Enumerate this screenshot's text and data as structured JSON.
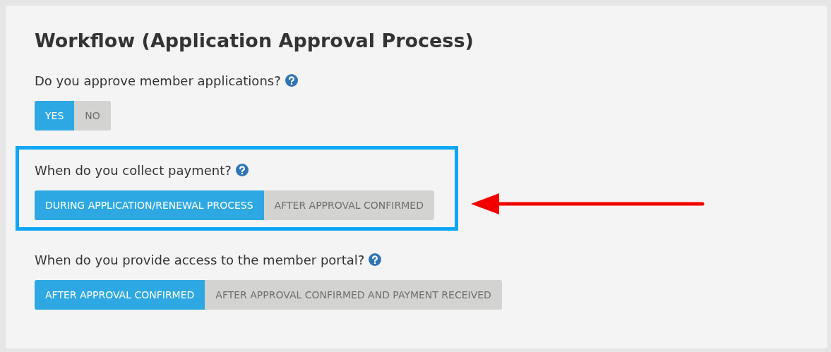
{
  "title": "Workflow (Application Approval Process)",
  "questions": [
    {
      "label": "Do you approve member applications?",
      "highlighted": false,
      "options": [
        {
          "label": "YES",
          "selected": true
        },
        {
          "label": "NO",
          "selected": false
        }
      ]
    },
    {
      "label": "When do you collect payment?",
      "highlighted": true,
      "options": [
        {
          "label": "DURING APPLICATION/RENEWAL PROCESS",
          "selected": true
        },
        {
          "label": "AFTER APPROVAL CONFIRMED",
          "selected": false
        }
      ]
    },
    {
      "label": "When do you provide access to the member portal?",
      "highlighted": false,
      "options": [
        {
          "label": "AFTER APPROVAL CONFIRMED",
          "selected": true
        },
        {
          "label": "AFTER APPROVAL CONFIRMED AND PAYMENT RECEIVED",
          "selected": false
        }
      ]
    }
  ]
}
